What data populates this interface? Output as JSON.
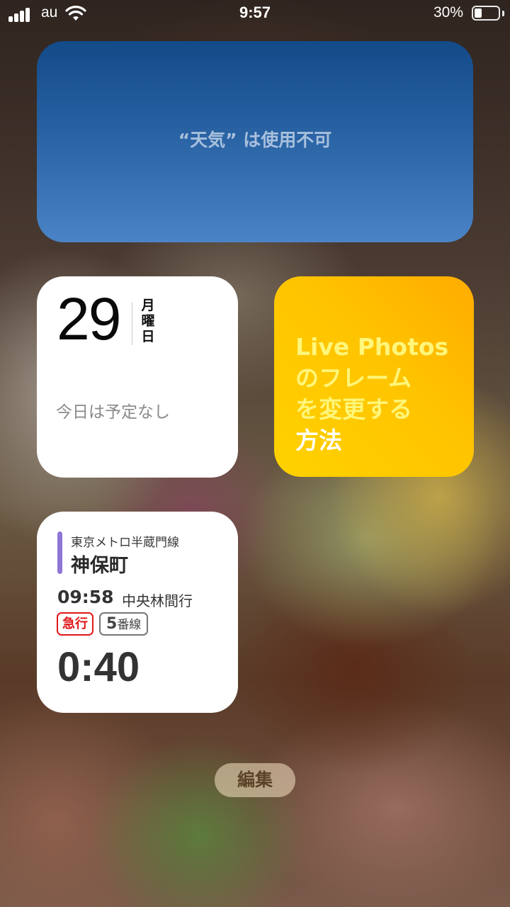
{
  "status_bar": {
    "carrier": "au",
    "time": "9:57",
    "battery_percent": "30%",
    "battery_level": 0.3,
    "signal_icon": "cellular-signal-icon",
    "wifi_icon": "wifi-icon",
    "battery_icon": "battery-icon"
  },
  "weather_widget": {
    "message": "“天気” は使用不可",
    "colors": {
      "top": "#134a88",
      "bottom": "#4a84c6"
    }
  },
  "calendar_widget": {
    "day": "29",
    "weekday_chars": [
      "月",
      "曜",
      "日"
    ],
    "empty_message": "今日は予定なし"
  },
  "tips_widget": {
    "lines": [
      "Live Photos",
      "のフレーム",
      "を変更する",
      "方法"
    ],
    "colors": {
      "text": "#fff67a",
      "background": "#ffc400"
    }
  },
  "transit_widget": {
    "line_name": "東京メトロ半蔵門線",
    "line_color": "#8f76d6",
    "station": "神保町",
    "departure_time": "09:58",
    "destination": "中央林間行",
    "train_type": "急行",
    "train_type_color": "#e01818",
    "track_number": "5",
    "track_unit": "番線",
    "countdown": "0:40"
  },
  "edit_button": {
    "label": "編集"
  }
}
